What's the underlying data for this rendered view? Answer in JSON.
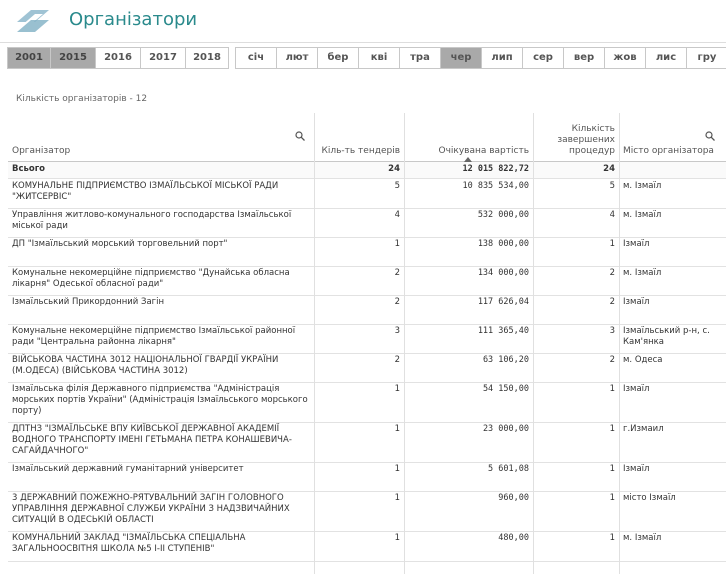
{
  "header": {
    "title": "Організатори"
  },
  "years": [
    "2001",
    "2015",
    "2016",
    "2017",
    "2018"
  ],
  "selected_years": [
    "2001",
    "2015"
  ],
  "months": [
    "січ",
    "лют",
    "бер",
    "кві",
    "тра",
    "чер",
    "лип",
    "сер",
    "вер",
    "жов",
    "лис",
    "гру"
  ],
  "selected_month": "чер",
  "count_label": "Кількість організаторів - 12",
  "table": {
    "columns": {
      "org": "Організатор",
      "tenders": "Кіль-ть тендерів",
      "value": "Очікувана вартість",
      "completed": "Кількість завершених процедур",
      "city": "Місто організатора"
    },
    "total": {
      "label": "Всього",
      "tenders": "24",
      "value": "12 015 822,72",
      "completed": "24",
      "city": ""
    },
    "rows": [
      {
        "org": "КОМУНАЛЬНЕ ПІДПРИЄМСТВО ІЗМАЇЛЬСЬКОЇ МІСЬКОЇ РАДИ \"ЖИТСЕРВІС\"",
        "tenders": "5",
        "value": "10 835 534,00",
        "completed": "5",
        "city": "м. Ізмаїл"
      },
      {
        "org": "Управління житлово-комунального господарства Ізмаїльської міської ради",
        "tenders": "4",
        "value": "532 000,00",
        "completed": "4",
        "city": "м. Ізмаїл"
      },
      {
        "org": "ДП \"Ізмаїльський морський торговельний порт\"",
        "tenders": "1",
        "value": "138 000,00",
        "completed": "1",
        "city": "Ізмаїл"
      },
      {
        "org": "Комунальне некомерційне підприємство \"Дунайська обласна лікарня\" Одеської обласної ради\"",
        "tenders": "2",
        "value": "134 000,00",
        "completed": "2",
        "city": "м. Ізмаїл"
      },
      {
        "org": "Ізмаїльський Прикордонний Загін",
        "tenders": "2",
        "value": "117 626,04",
        "completed": "2",
        "city": "Ізмаїл"
      },
      {
        "org": "Комунальне некомерційне підприємство Ізмаїльської районної ради \"Центральна районна лікарня\"",
        "tenders": "3",
        "value": "111 365,40",
        "completed": "3",
        "city": "Ізмаїльський р-н, с. Кам'янка"
      },
      {
        "org": "ВІЙСЬКОВА ЧАСТИНА 3012 НАЦІОНАЛЬНОЇ ГВАРДІЇ УКРАЇНИ (М.ОДЕСА) (ВІЙСЬКОВА ЧАСТИНА 3012)",
        "tenders": "2",
        "value": "63 106,20",
        "completed": "2",
        "city": "м. Одеса"
      },
      {
        "org": "Ізмаїльська філія Державного підприємства \"Адміністрація морських портів України\" (Адміністрація Ізмаїльського морського порту)",
        "tenders": "1",
        "value": "54 150,00",
        "completed": "1",
        "city": "Ізмаїл"
      },
      {
        "org": "ДПТНЗ \"ІЗМАЇЛЬСЬКЕ ВПУ КИЇВСЬКОЇ ДЕРЖАВНОЇ АКАДЕМІЇ ВОДНОГО ТРАНСПОРТУ ІМЕНІ ГЕТЬМАНА ПЕТРА КОНАШЕВИЧА-САГАЙДАЧНОГО\"",
        "tenders": "1",
        "value": "23 000,00",
        "completed": "1",
        "city": "г.Измаил"
      },
      {
        "org": "Ізмаїльський державний гуманітарний університет",
        "tenders": "1",
        "value": "5 601,08",
        "completed": "1",
        "city": "Ізмаїл"
      },
      {
        "org": "3 ДЕРЖАВНИЙ ПОЖЕЖНО-РЯТУВАЛЬНИЙ ЗАГІН ГОЛОВНОГО УПРАВЛІННЯ ДЕРЖАВНОЇ СЛУЖБИ УКРАЇНИ З НАДЗВИЧАЙНИХ СИТУАЦІЙ В ОДЕСЬКІЙ ОБЛАСТІ",
        "tenders": "1",
        "value": "960,00",
        "completed": "1",
        "city": "місто Ізмаїл"
      },
      {
        "org": "КОМУНАЛЬНИЙ ЗАКЛАД \"ІЗМАЇЛЬСЬКА СПЕЦІАЛЬНА ЗАГАЛЬНООСВІТНЯ ШКОЛА №5 I-II СТУПЕНІВ\"",
        "tenders": "1",
        "value": "480,00",
        "completed": "1",
        "city": "м. Ізмаїл"
      }
    ]
  },
  "colors": {
    "accent": "#2a8a8c",
    "selected": "#a9a9a9"
  },
  "icons": {
    "logo": "logo-icon",
    "search": "search-icon",
    "sort": "sort-desc-icon"
  }
}
